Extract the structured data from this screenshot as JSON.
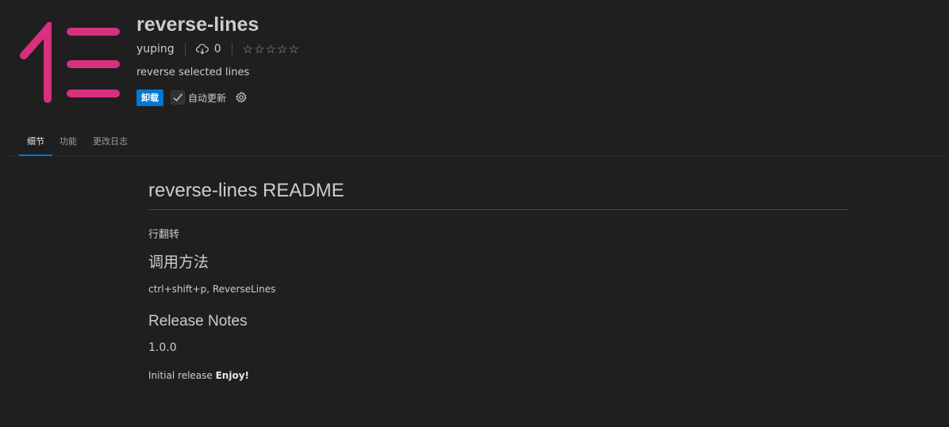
{
  "extension": {
    "name": "reverse-lines",
    "publisher": "yuping",
    "install_count": "0",
    "rating_stars": 5,
    "description": "reverse selected lines",
    "icon_color": "#d6307f"
  },
  "actions": {
    "uninstall_label": "卸载",
    "auto_update_label": "自动更新",
    "auto_update_checked": true
  },
  "tabs": [
    {
      "label": "细节",
      "active": true
    },
    {
      "label": "功能",
      "active": false
    },
    {
      "label": "更改日志",
      "active": false
    }
  ],
  "readme": {
    "title": "reverse-lines README",
    "intro": "行翻转",
    "usage_heading": "调用方法",
    "usage_text": "ctrl+shift+p, ReverseLines",
    "release_heading": "Release Notes",
    "version": "1.0.0",
    "release_text": "Initial release",
    "release_text_bold": "Enjoy!"
  },
  "colors": {
    "background": "#1f1f1f",
    "accent": "#0078d4",
    "icon": "#d6307f"
  }
}
